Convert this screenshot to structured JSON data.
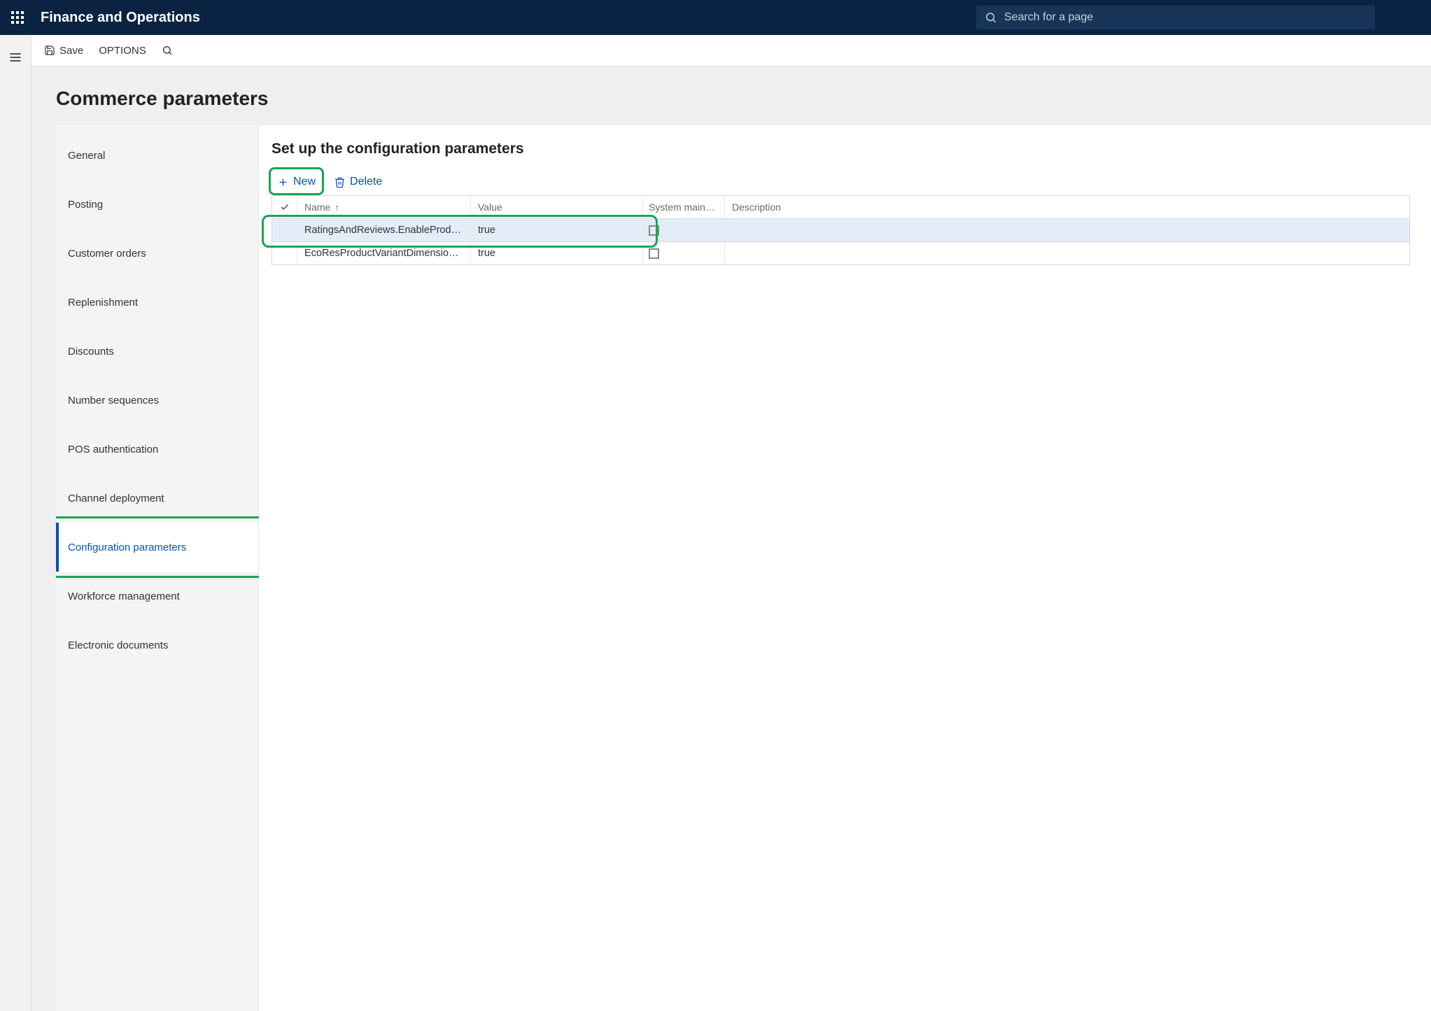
{
  "header": {
    "app_title": "Finance and Operations",
    "search_placeholder": "Search for a page"
  },
  "actionbar": {
    "save_label": "Save",
    "options_label": "OPTIONS"
  },
  "page": {
    "title": "Commerce parameters",
    "section_title": "Set up the configuration parameters"
  },
  "sidenav": {
    "items": [
      "General",
      "Posting",
      "Customer orders",
      "Replenishment",
      "Discounts",
      "Number sequences",
      "POS authentication",
      "Channel deployment",
      "Configuration parameters",
      "Workforce management",
      "Electronic documents"
    ],
    "selected_index": 8
  },
  "toolbar": {
    "new_label": "New",
    "delete_label": "Delete"
  },
  "grid": {
    "columns": {
      "name": "Name",
      "value": "Value",
      "system": "System maintai…",
      "description": "Description"
    },
    "rows": [
      {
        "name": "RatingsAndReviews.EnableProd…",
        "value": "true",
        "system": false,
        "description": "",
        "selected": true
      },
      {
        "name": "EcoResProductVariantDimensio…",
        "value": "true",
        "system": false,
        "description": "",
        "selected": false
      }
    ]
  }
}
